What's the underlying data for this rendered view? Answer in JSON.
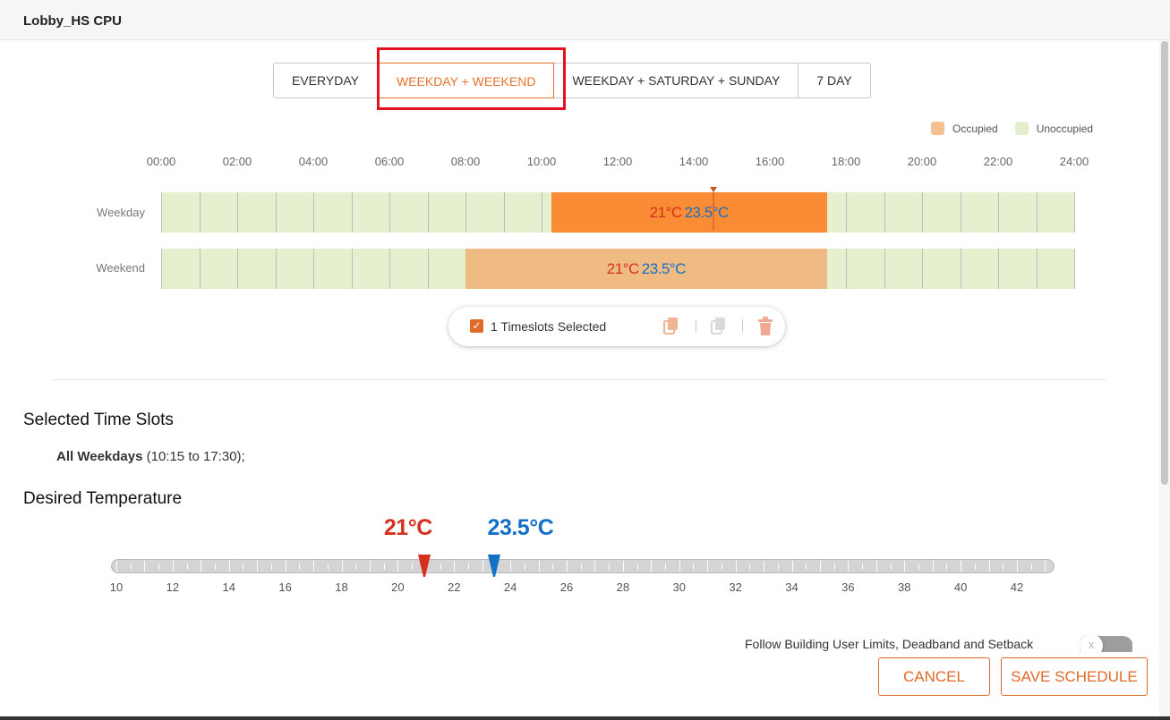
{
  "window": {
    "title": "Lobby_HS CPU"
  },
  "tabs": [
    {
      "label": "EVERYDAY"
    },
    {
      "label": "WEEKDAY + WEEKEND"
    },
    {
      "label": "WEEKDAY + SATURDAY + SUNDAY"
    },
    {
      "label": "7 DAY"
    }
  ],
  "active_tab": "WEEKDAY + WEEKEND",
  "legend": {
    "occupied": "Occupied",
    "unoccupied": "Unoccupied"
  },
  "colors": {
    "accent": "#e06a2a",
    "occupied_selected": "#fa8c36",
    "occupied": "#f0bb82",
    "unoccupied": "#e6f0cf",
    "heating": "#d52f1e",
    "cooling": "#1470c6",
    "annotation_box": "#e3101f"
  },
  "timeline": {
    "hour_labels": [
      "00:00",
      "02:00",
      "04:00",
      "06:00",
      "08:00",
      "10:00",
      "12:00",
      "14:00",
      "16:00",
      "18:00",
      "20:00",
      "22:00",
      "24:00"
    ],
    "rows": [
      {
        "label": "Weekday",
        "block": {
          "start": "10:15",
          "end": "17:30",
          "heat": "21°C",
          "cool": "23.5°C",
          "selected": true
        }
      },
      {
        "label": "Weekend",
        "block": {
          "start": "08:00",
          "end": "17:30",
          "heat": "21°C",
          "cool": "23.5°C",
          "selected": false
        }
      }
    ]
  },
  "selection_toolbar": {
    "checked": true,
    "label": "1 Timeslots Selected",
    "icons": [
      "copy-icon",
      "paste-icon",
      "trash-icon"
    ]
  },
  "selected_slots": {
    "heading": "Selected Time Slots",
    "day": "All Weekdays",
    "range": " (10:15 to 17:30);"
  },
  "desired_temperature": {
    "heading": "Desired Temperature",
    "heat_label": "21°C",
    "cool_label": "23.5°C",
    "heat_value": 21,
    "cool_value": 23.5,
    "scale_min": 10,
    "scale_max": 43,
    "scale_labels": [
      "10",
      "12",
      "14",
      "16",
      "18",
      "20",
      "22",
      "24",
      "26",
      "28",
      "30",
      "32",
      "34",
      "36",
      "38",
      "40",
      "42"
    ]
  },
  "follow_limits": {
    "label": "Follow Building User Limits, Deadband and Setback",
    "enabled": false,
    "toggle_glyph": "x"
  },
  "buttons": {
    "cancel": "CANCEL",
    "save": "SAVE SCHEDULE"
  }
}
